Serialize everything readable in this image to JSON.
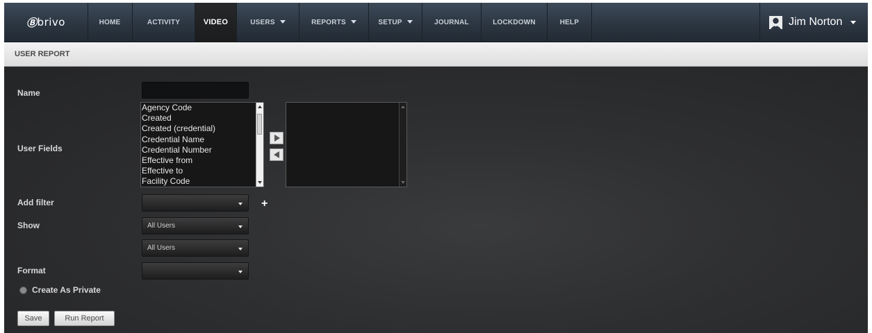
{
  "brand": {
    "logo_text": "brivo"
  },
  "nav": {
    "items": [
      {
        "label": "HOME"
      },
      {
        "label": "ACTIVITY"
      },
      {
        "label": "VIDEO"
      },
      {
        "label": "USERS"
      },
      {
        "label": "REPORTS"
      },
      {
        "label": "SETUP"
      },
      {
        "label": "JOURNAL"
      },
      {
        "label": "LOCKDOWN"
      },
      {
        "label": "HELP"
      }
    ],
    "active_item": "VIDEO",
    "user_name": "Jim Norton"
  },
  "page": {
    "title": "USER REPORT"
  },
  "form": {
    "name": {
      "label": "Name",
      "value": ""
    },
    "user_fields": {
      "label": "User Fields",
      "available": [
        "Agency Code",
        "Created",
        "Created (credential)",
        "Credential Name",
        "Credential Number",
        "Effective from",
        "Effective to",
        "Facility Code"
      ],
      "selected": []
    },
    "add_filter": {
      "label": "Add filter",
      "value": ""
    },
    "show": {
      "label": "Show",
      "value_1": "All Users",
      "value_2": "All Users"
    },
    "format": {
      "label": "Format",
      "value": ""
    },
    "private": {
      "label": "Create As Private",
      "checked": false
    },
    "buttons": {
      "save": "Save",
      "run_report": "Run Report"
    }
  }
}
